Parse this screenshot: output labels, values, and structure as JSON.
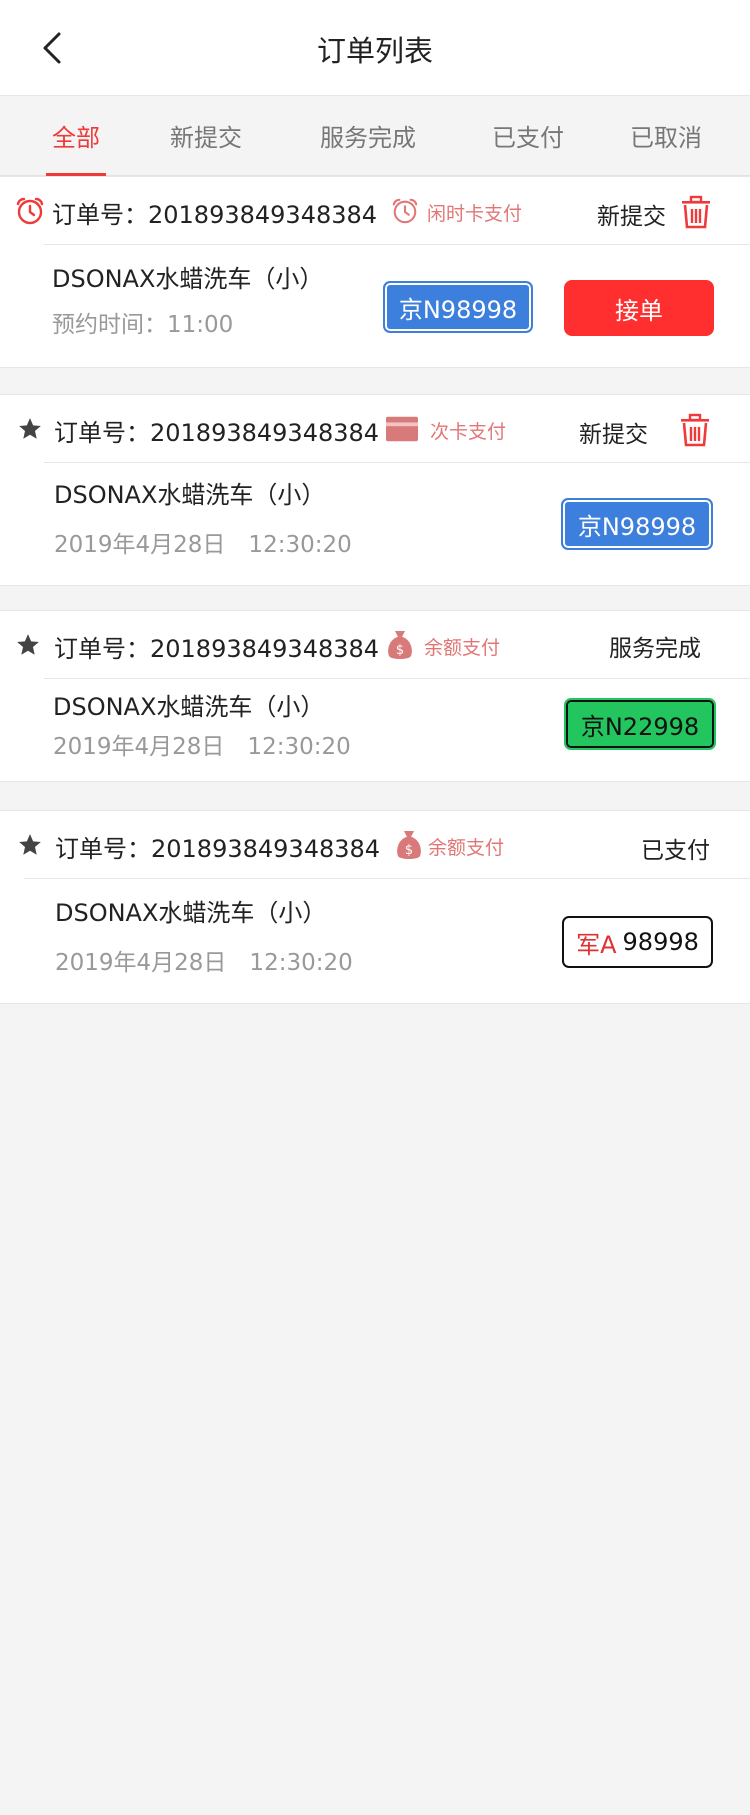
{
  "header": {
    "title": "订单列表",
    "back_icon": "chevron-left-icon"
  },
  "tabs": [
    {
      "label": "全部",
      "active": true
    },
    {
      "label": "新提交",
      "active": false
    },
    {
      "label": "服务完成",
      "active": false
    },
    {
      "label": "已支付",
      "active": false
    },
    {
      "label": "已取消",
      "active": false
    }
  ],
  "colors": {
    "accent_red": "#ef3a3a",
    "pay_text": "#e27676",
    "plate_blue": "#3d7fdd",
    "plate_green": "#22c55e"
  },
  "orders": [
    {
      "lead_icon": "alarm-clock-icon",
      "order_label": "订单号：201893849348384",
      "pay_icon": "alarm-clock-icon",
      "pay_method": "闲时卡支付",
      "status": "新提交",
      "has_delete": true,
      "service": "DSONAX水蜡洗车（小）",
      "time_line": "预约时间：11:00",
      "plate": {
        "style": "blue",
        "prefix": "",
        "text": "京N98998"
      },
      "action_label": "接单"
    },
    {
      "lead_icon": "star-icon",
      "order_label": "订单号：201893849348384",
      "pay_icon": "card-icon",
      "pay_method": "次卡支付",
      "status": "新提交",
      "has_delete": true,
      "service": "DSONAX水蜡洗车（小）",
      "time_line": "2019年4月28日　12:30:20",
      "plate": {
        "style": "blue",
        "prefix": "",
        "text": "京N98998"
      }
    },
    {
      "lead_icon": "star-icon",
      "order_label": "订单号：201893849348384",
      "pay_icon": "money-bag-icon",
      "pay_method": "余额支付",
      "status": "服务完成",
      "has_delete": false,
      "service": "DSONAX水蜡洗车（小）",
      "time_line": "2019年4月28日　12:30:20",
      "plate": {
        "style": "green",
        "prefix": "",
        "text": "京N22998"
      }
    },
    {
      "lead_icon": "star-icon",
      "order_label": "订单号：201893849348384",
      "pay_icon": "money-bag-icon",
      "pay_method": "余额支付",
      "status": "已支付",
      "has_delete": false,
      "service": "DSONAX水蜡洗车（小）",
      "time_line": "2019年4月28日　12:30:20",
      "plate": {
        "style": "white",
        "prefix": "军A",
        "text": "98998"
      }
    }
  ]
}
